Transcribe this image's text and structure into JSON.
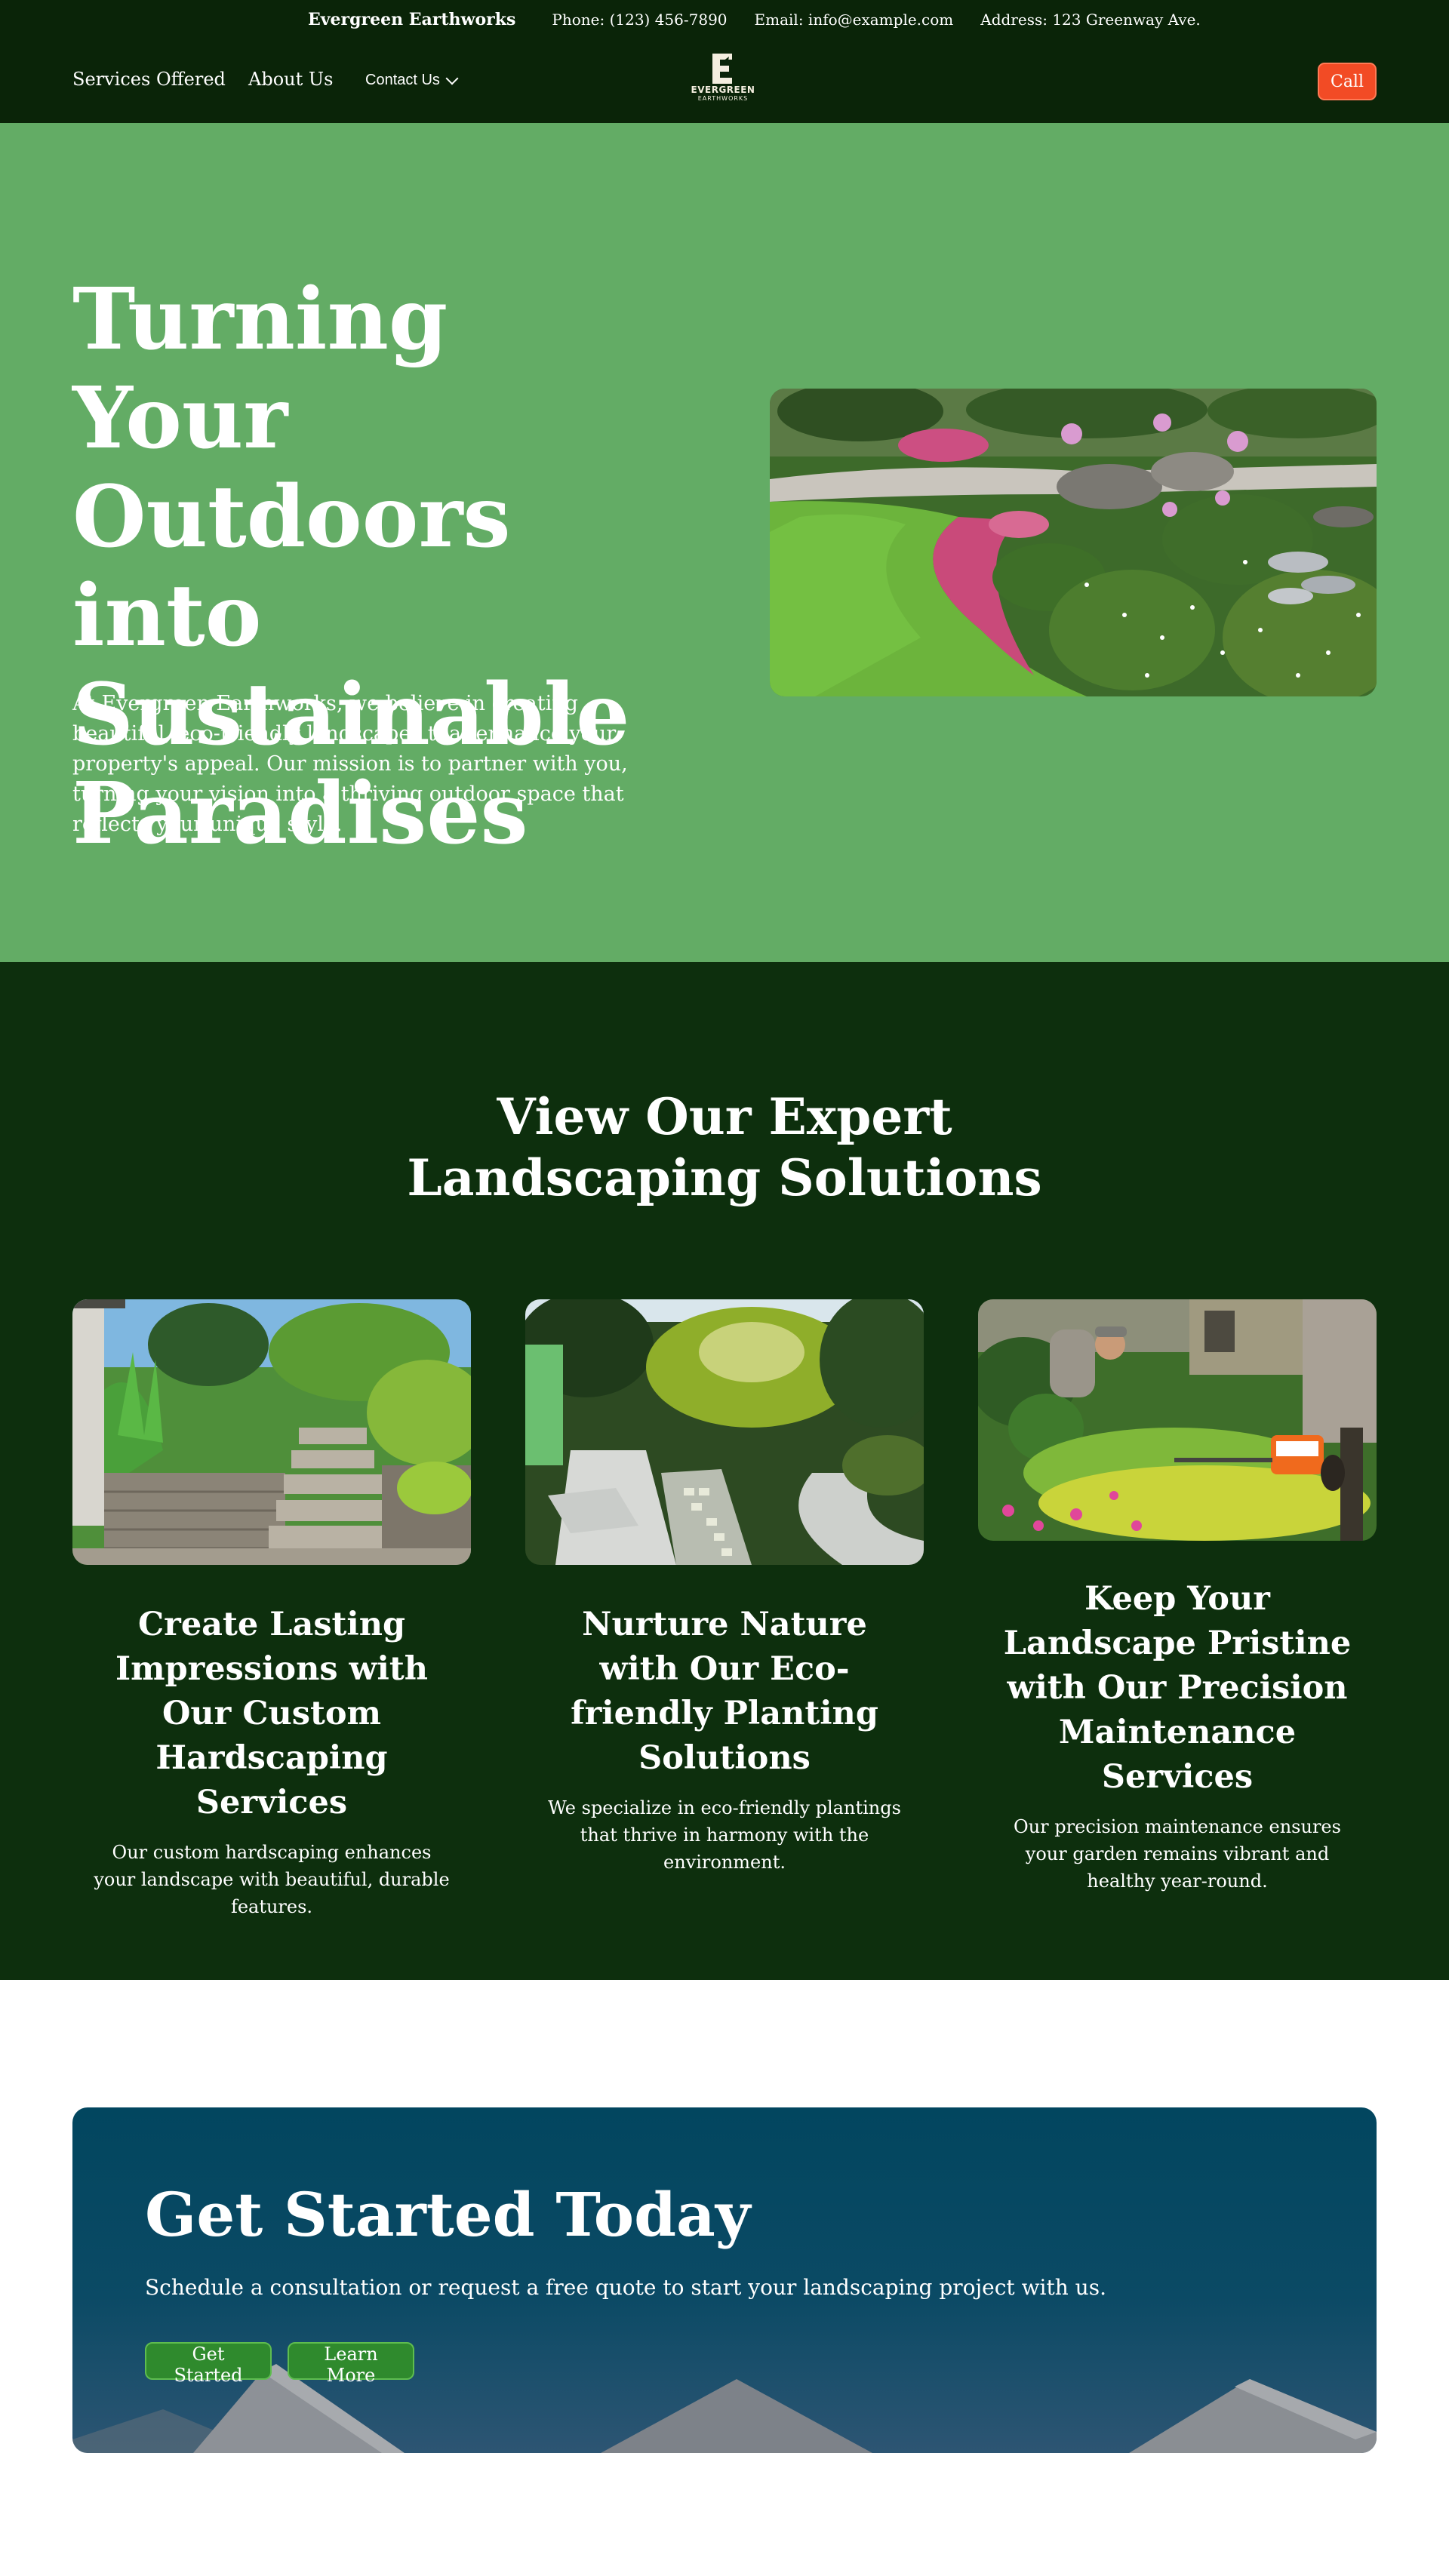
{
  "topbar": {
    "brand": "Evergreen Earthworks",
    "phone": "Phone: (123) 456-7890",
    "email": "Email: info@example.com",
    "address": "Address: 123 Greenway Ave."
  },
  "nav": {
    "services": "Services Offered",
    "about": "About Us",
    "contact": "Contact Us",
    "call": "Call"
  },
  "logo": {
    "line1": "EVERGREEN",
    "line2": "EARTHWORKS"
  },
  "hero": {
    "title": "Turning Your Outdoors into Sustainable Paradises",
    "text": "At Evergreen Earthworks, we believe in creating beautiful, eco-friendly landscapes that enhance your property's appeal. Our mission is to partner with you, turning your vision into a thriving outdoor space that reflects your unique style."
  },
  "services": {
    "title": "View Our Expert Landscaping Solutions",
    "cards": [
      {
        "title": "Create Lasting Impressions with Our Custom Hardscaping Services",
        "text": "Our custom hardscaping enhances your landscape with beautiful, durable features."
      },
      {
        "title": "Nurture Nature with Our Eco-friendly Planting Solutions",
        "text": "We specialize in eco-friendly plantings that thrive in harmony with the environment."
      },
      {
        "title": "Keep Your Landscape Pristine with Our Precision Maintenance Services",
        "text": "Our precision maintenance ensures your garden remains vibrant and healthy year-round."
      }
    ]
  },
  "cta": {
    "title": "Get Started Today",
    "text": "Schedule a consultation or request a free quote to start your landscaping project with us.",
    "start": "Get Started",
    "learn": "Learn More"
  },
  "colors": {
    "header": "#0a2408",
    "hero": "#63ac65",
    "services": "#0d2f0d",
    "accent": "#f24b25",
    "button": "#2f8a2d"
  }
}
